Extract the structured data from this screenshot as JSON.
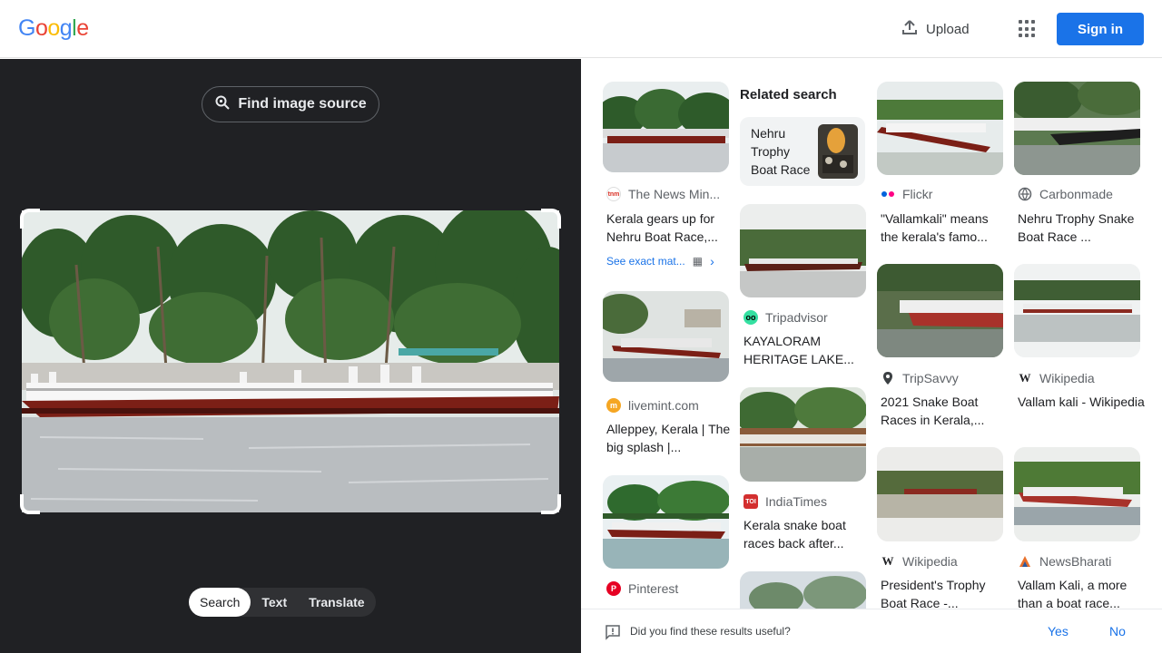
{
  "header": {
    "logo_text": "Google",
    "upload_label": "Upload",
    "apps_icon": "apps-grid-icon",
    "sign_in_label": "Sign in",
    "accent_color": "#1a73e8"
  },
  "lens": {
    "find_source_label": "Find image source",
    "modes": [
      "Search",
      "Text",
      "Translate"
    ],
    "active_mode": "Search"
  },
  "results": {
    "related_heading": "Related search",
    "related_chip_label": "Nehru Trophy Boat Race",
    "see_exact_label": "See exact mat...",
    "cards": [
      {
        "source": "The News Min...",
        "title": "Kerala gears up for Nehru Boat Race,..."
      },
      {
        "source": "livemint.com",
        "title": "Alleppey, Kerala | The big splash |..."
      },
      {
        "source": "Pinterest",
        "title": ""
      },
      {
        "source": "Tripadvisor",
        "title": "KAYALORAM HERITAGE LAKE..."
      },
      {
        "source": "IndiaTimes",
        "title": "Kerala snake boat races back after..."
      },
      {
        "source": "Flickr",
        "title": "\"Vallamkali\" means the kerala's famo..."
      },
      {
        "source": "TripSavvy",
        "title": "2021 Snake Boat Races in Kerala,..."
      },
      {
        "source": "Wikipedia",
        "title": "President's Trophy Boat Race -..."
      },
      {
        "source": "Carbonmade",
        "title": "Nehru Trophy Snake Boat Race ..."
      },
      {
        "source": "Wikipedia",
        "title": "Vallam kali - Wikipedia"
      },
      {
        "source": "NewsBharati",
        "title": "Vallam Kali, a more than a boat race..."
      }
    ]
  },
  "feedback": {
    "question": "Did you find these results useful?",
    "yes_label": "Yes",
    "no_label": "No"
  }
}
